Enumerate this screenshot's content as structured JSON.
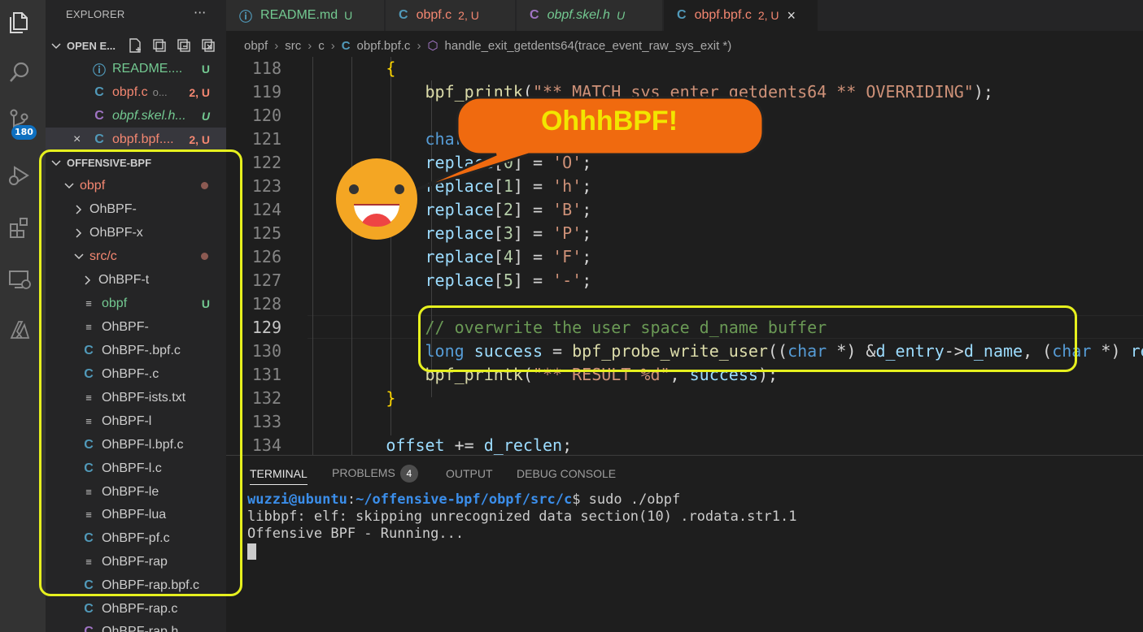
{
  "activity_bar": {
    "items": [
      "files-icon",
      "search-icon",
      "source-control-icon",
      "run-debug-icon",
      "extensions-icon",
      "remote-explorer-icon",
      "azure-icon"
    ],
    "scm_badge": "180"
  },
  "sidebar": {
    "title": "EXPLORER",
    "more": "···",
    "open_editors": {
      "label": "OPEN E...",
      "items": [
        {
          "icon": "ⓘ",
          "name": "README....",
          "status": "U"
        },
        {
          "icon": "C",
          "name": "obpf.c",
          "extra": "o...",
          "status": "2, U"
        },
        {
          "icon": "C",
          "name": "obpf.skel.h...",
          "status": "U"
        },
        {
          "icon": "C",
          "name": "obpf.bpf....",
          "status": "2, U",
          "close": "×"
        }
      ]
    },
    "project": {
      "label": "OFFENSIVE-BPF",
      "items": [
        {
          "type": "folder-open",
          "name": "obpf",
          "depth": 1
        },
        {
          "type": "folder",
          "name": "OhBPF-",
          "depth": 2
        },
        {
          "type": "folder",
          "name": "OhBPF-x",
          "depth": 2
        },
        {
          "type": "folder-open",
          "name": "src/c",
          "depth": 2
        },
        {
          "type": "folder",
          "name": "OhBPF-t",
          "depth": 3
        },
        {
          "type": "file",
          "name": "obpf",
          "depth": 3,
          "status": "U"
        },
        {
          "type": "file",
          "name": "OhBPF-",
          "depth": 3
        },
        {
          "type": "c",
          "name": "OhBPF-.bpf.c",
          "depth": 3
        },
        {
          "type": "c",
          "name": "OhBPF-.c",
          "depth": 3
        },
        {
          "type": "file",
          "name": "OhBPF-ists.txt",
          "depth": 3
        },
        {
          "type": "file",
          "name": "OhBPF-l",
          "depth": 3
        },
        {
          "type": "c",
          "name": "OhBPF-l.bpf.c",
          "depth": 3
        },
        {
          "type": "c",
          "name": "OhBPF-l.c",
          "depth": 3
        },
        {
          "type": "file",
          "name": "OhBPF-le",
          "depth": 3
        },
        {
          "type": "file",
          "name": "OhBPF-lua",
          "depth": 3
        },
        {
          "type": "c",
          "name": "OhBPF-pf.c",
          "depth": 3
        },
        {
          "type": "file",
          "name": "OhBPF-rap",
          "depth": 3
        },
        {
          "type": "c",
          "name": "OhBPF-rap.bpf.c",
          "depth": 3
        },
        {
          "type": "c",
          "name": "OhBPF-rap.c",
          "depth": 3
        },
        {
          "type": "c",
          "name": "OhBPF-rap.h",
          "depth": 3
        }
      ]
    }
  },
  "tabs": [
    {
      "icon": "ⓘ",
      "label": "README.md",
      "status": "U"
    },
    {
      "icon": "C",
      "label": "obpf.c",
      "status": "2, U"
    },
    {
      "icon": "C",
      "label": "obpf.skel.h",
      "status": "U"
    },
    {
      "icon": "C",
      "label": "obpf.bpf.c",
      "status": "2, U",
      "close": "×"
    }
  ],
  "breadcrumb": {
    "parts": [
      "obpf",
      "src",
      "c"
    ],
    "file": "obpf.bpf.c",
    "symbol": "handle_exit_getdents64(trace_event_raw_sys_exit *)"
  },
  "editor": {
    "line_numbers": [
      "118",
      "119",
      "120",
      "121",
      "122",
      "123",
      "124",
      "125",
      "126",
      "127",
      "128",
      "129",
      "130",
      "131",
      "132",
      "133",
      "134"
    ],
    "current_line": "129"
  },
  "panel": {
    "tabs": [
      "TERMINAL",
      "PROBLEMS",
      "OUTPUT",
      "DEBUG CONSOLE"
    ],
    "problems_count": "4",
    "prompt_user": "wuzzi@ubuntu",
    "prompt_path": "~/offensive-bpf/obpf/src/c",
    "prompt_cmd": "$ sudo ./obpf",
    "output_line1": "libbpf: elf: skipping unrecognized data section(10) .rodata.str1.1",
    "output_line2": "Offensive BPF - Running..."
  },
  "callout": {
    "text": "OhhhBPF!",
    "bubble_color": "#f06a0f",
    "text_color": "#f2e600",
    "highlight_color": "#e6f01e"
  }
}
